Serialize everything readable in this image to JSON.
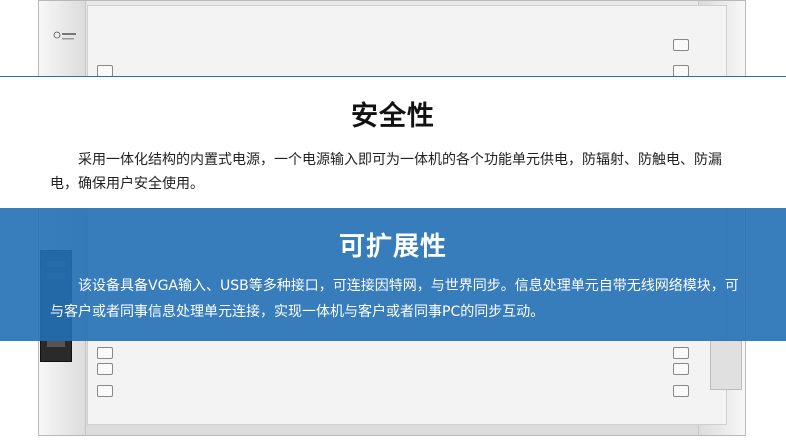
{
  "sections": {
    "safety": {
      "title": "安全性",
      "body": "采用一体化结构的内置式电源，一个电源输入即可为一体机的各个功能单元供电，防辐射、防触电、防漏电，确保用户安全使用。"
    },
    "expandability": {
      "title": "可扩展性",
      "body": "该设备具备VGA输入、USB等多种接口，可连接因特网，与世界同步。信息处理单元自带无线网络模块，可与客户或者同事信息处理单元连接，实现一体机与客户或者同事PC的同步互动。"
    }
  },
  "colors": {
    "accent": "#2270b6",
    "rule": "#2f6fa8"
  }
}
